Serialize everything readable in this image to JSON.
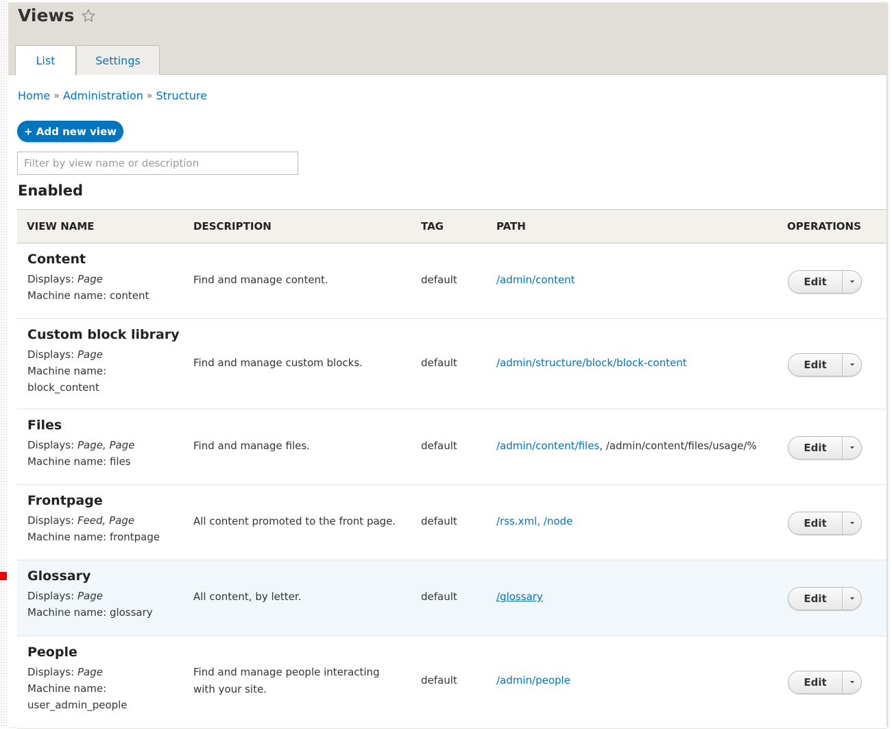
{
  "page": {
    "title": "Views",
    "tabs": [
      {
        "label": "List"
      },
      {
        "label": "Settings"
      }
    ],
    "breadcrumb": [
      {
        "label": "Home"
      },
      {
        "label": "Administration"
      },
      {
        "label": "Structure"
      }
    ],
    "breadcrumb_sep": "»",
    "add_button": "+ Add new view",
    "filter_placeholder": "Filter by view name or description",
    "section_title": "Enabled"
  },
  "table": {
    "headers": {
      "view_name": "VIEW NAME",
      "description": "DESCRIPTION",
      "tag": "TAG",
      "path": "PATH",
      "operations": "OPERATIONS"
    },
    "displays_label": "Displays:",
    "machine_label": "Machine name:",
    "edit_label": "Edit",
    "rows": [
      {
        "name": "Content",
        "displays": "Page",
        "machine_name": "content",
        "description": "Find and manage content.",
        "tag": "default",
        "path": "/admin/content"
      },
      {
        "name": "Custom block library",
        "displays": "Page",
        "machine_name": "block_content",
        "description": "Find and manage custom blocks.",
        "tag": "default",
        "path": "/admin/structure/block/block-content"
      },
      {
        "name": "Files",
        "displays": "Page, Page",
        "machine_name": "files",
        "description": "Find and manage files.",
        "tag": "default",
        "path": "/admin/content/files",
        "path_extra": ", /admin/content/files/usage/%"
      },
      {
        "name": "Frontpage",
        "displays": "Feed, Page",
        "machine_name": "frontpage",
        "description": "All content promoted to the front page.",
        "tag": "default",
        "path": "/rss.xml, /node"
      },
      {
        "name": "Glossary",
        "displays": "Page",
        "machine_name": "glossary",
        "description": "All content, by letter.",
        "tag": "default",
        "path": "/glossary"
      },
      {
        "name": "People",
        "displays": "Page",
        "machine_name": "user_admin_people",
        "description_line1": "Find and manage people interacting",
        "description_line2": "with your site.",
        "tag": "default",
        "path": "/admin/people"
      }
    ]
  },
  "colors": {
    "link": "#0074bd",
    "header_bg": "#e0ded7",
    "highlight_row": "#f2f7fb"
  }
}
